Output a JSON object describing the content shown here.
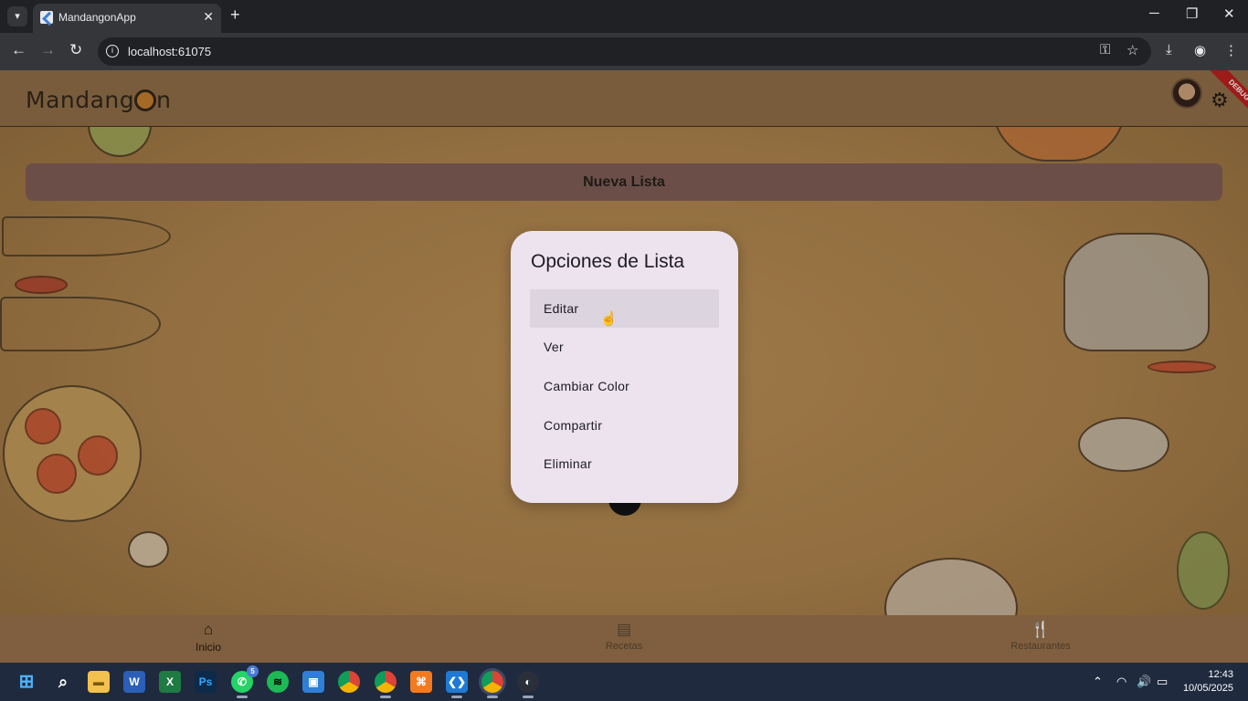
{
  "browser": {
    "tab_title": "MandangonApp",
    "url": "localhost:61075"
  },
  "app": {
    "logo_text_pre": "Mandang",
    "logo_text_post": "n",
    "debug_banner": "DEBUG",
    "new_list_button": "Nueva Lista"
  },
  "dialog": {
    "title": "Opciones de Lista",
    "options": [
      {
        "label": "Editar"
      },
      {
        "label": "Ver"
      },
      {
        "label": "Cambiar Color"
      },
      {
        "label": "Compartir"
      },
      {
        "label": "Eliminar"
      }
    ]
  },
  "bottom_nav": {
    "items": [
      {
        "label": "Inicio",
        "icon": "home-icon"
      },
      {
        "label": "Recetas",
        "icon": "book-icon"
      },
      {
        "label": "Restaurantes",
        "icon": "restaurant-icon"
      }
    ]
  },
  "taskbar": {
    "whatsapp_badge": "5",
    "time": "12:43",
    "date": "10/05/2025"
  },
  "colors": {
    "app_background": "#a9804c",
    "appbar": "#8c6b47",
    "new_list_button": "#7a5a55",
    "dialog_background": "#ece3ef",
    "debug_banner": "#b71c1c"
  }
}
